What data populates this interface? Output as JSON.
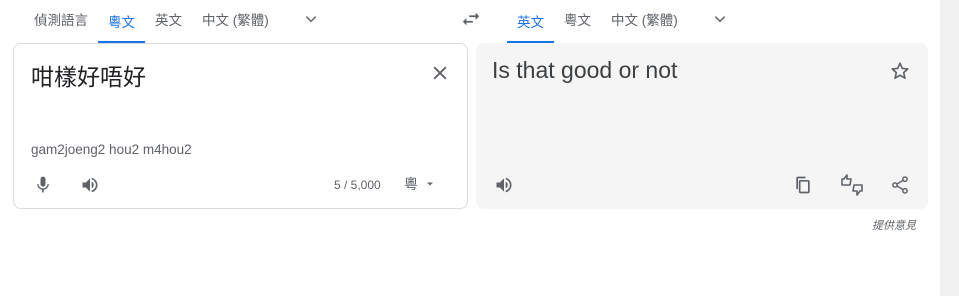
{
  "source_langs": {
    "tabs": [
      "偵測語言",
      "粵文",
      "英文",
      "中文 (繁體)"
    ],
    "active_index": 1,
    "more_icon": "chevron-down-icon"
  },
  "target_langs": {
    "tabs": [
      "英文",
      "粵文",
      "中文 (繁體)"
    ],
    "active_index": 0,
    "more_icon": "chevron-down-icon"
  },
  "swap_icon": "swap-arrows-icon",
  "source": {
    "text": "咁樣好唔好",
    "romanization": "gam2joeng2 hou2 m4hou2",
    "char_count": "5 / 5,000",
    "ime_label": "粵",
    "icons": [
      "close-icon",
      "microphone-icon",
      "speaker-icon",
      "dropdown-arrow-icon"
    ]
  },
  "target": {
    "text": "Is that good or not",
    "icons": [
      "star-icon",
      "speaker-icon",
      "copy-icon",
      "feedback-thumbs-icon",
      "share-icon"
    ]
  },
  "feedback_label": "提供意見",
  "colors": {
    "accent": "#1a73e8",
    "icon": "#5f6368",
    "target_bg": "#f5f5f5",
    "border": "#dadce0"
  }
}
